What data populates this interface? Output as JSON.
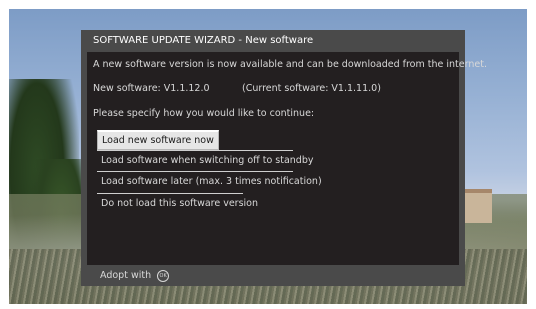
{
  "dialog": {
    "title": "SOFTWARE UPDATE WIZARD - New software",
    "message": "A new software version is now available and can be downloaded from the internet.",
    "new_software": "New software:  V1.1.12.0",
    "current_software": "(Current software:  V1.1.11.0)",
    "prompt": "Please specify how you would like to continue:",
    "options": [
      {
        "label": "Load new software now",
        "selected": true
      },
      {
        "label": "Load software when switching off to standby",
        "selected": false
      },
      {
        "label": "Load software later (max. 3 times notification)",
        "selected": false
      },
      {
        "label": "Do not load this software version",
        "selected": false
      }
    ],
    "footer": {
      "label": "Adopt with",
      "icon": "ok-button-icon",
      "icon_text": "OK"
    }
  },
  "colors": {
    "dialog_bg": "#231f20",
    "frame": "#4a4a4a",
    "text": "#d8d8d8",
    "selected_bg": "#e6e6e6"
  }
}
